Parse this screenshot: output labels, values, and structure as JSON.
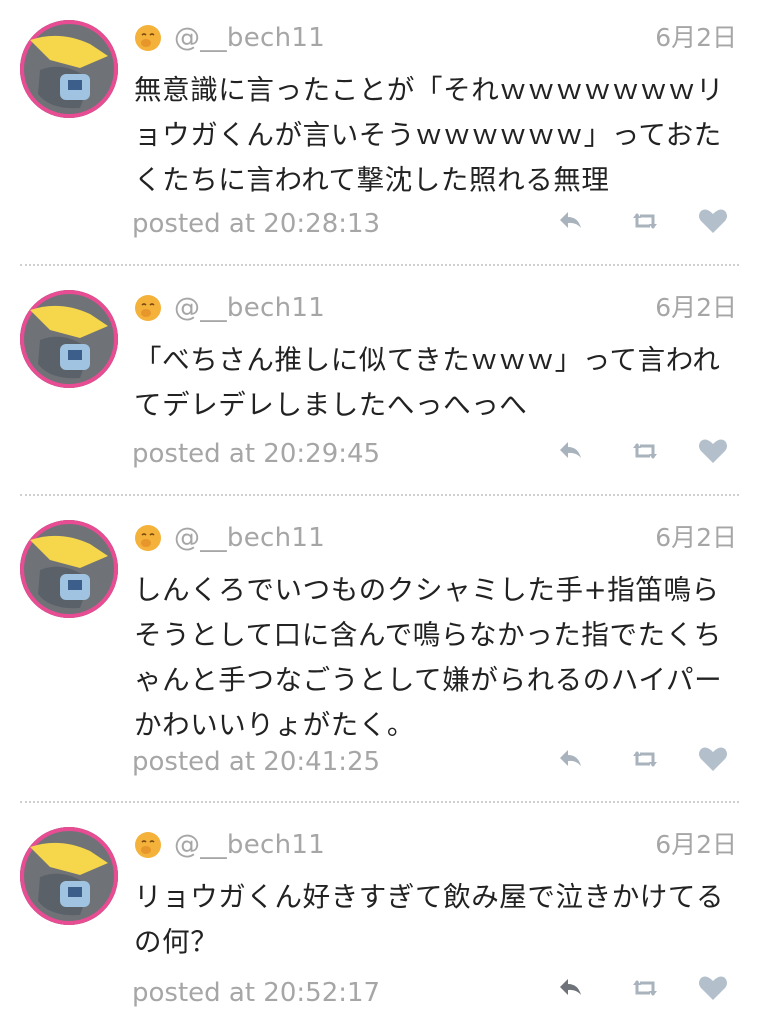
{
  "tweets": [
    {
      "handle": "@__bech11",
      "date": "6月2日",
      "text": "無意識に言ったことが「それｗｗｗｗｗｗｗリョウガくんが言いそうｗｗｗｗｗｗ」っておたくたちに言われて撃沈した照れる無理",
      "posted": "posted at 20:28:13",
      "icons": [
        "smiling-face-icon",
        "reply-icon",
        "retweet-icon",
        "heart-icon"
      ]
    },
    {
      "handle": "@__bech11",
      "date": "6月2日",
      "text": "「べちさん推しに似てきたｗｗｗ」って言われてデレデレしましたへっへっへ",
      "posted": "posted at 20:29:45",
      "icons": [
        "smiling-face-icon",
        "reply-icon",
        "retweet-icon",
        "heart-icon"
      ]
    },
    {
      "handle": "@__bech11",
      "date": "6月2日",
      "text": "しんくろでいつものクシャミした手+指笛鳴らそうとして口に含んで鳴らなかった指でたくちゃんと手つなごうとして嫌がられるのハイパーかわいいりょがたく。",
      "posted": "posted at 20:41:25",
      "icons": [
        "smiling-face-icon",
        "reply-icon",
        "retweet-icon",
        "heart-icon"
      ]
    },
    {
      "handle": "@__bech11",
      "date": "6月2日",
      "text": "リョウガくん好きすぎて飲み屋で泣きかけてるの何？",
      "posted": "posted at 20:52:17",
      "icons": [
        "smiling-face-icon",
        "reply-icon",
        "retweet-icon",
        "heart-icon"
      ]
    }
  ],
  "colors": {
    "text": "#222222",
    "muted": "#a6a6a6",
    "icon": "#a9b3bd",
    "heart": "#b3c0cb",
    "divider": "#cfcfcf",
    "emoji": "#f4b23a"
  }
}
